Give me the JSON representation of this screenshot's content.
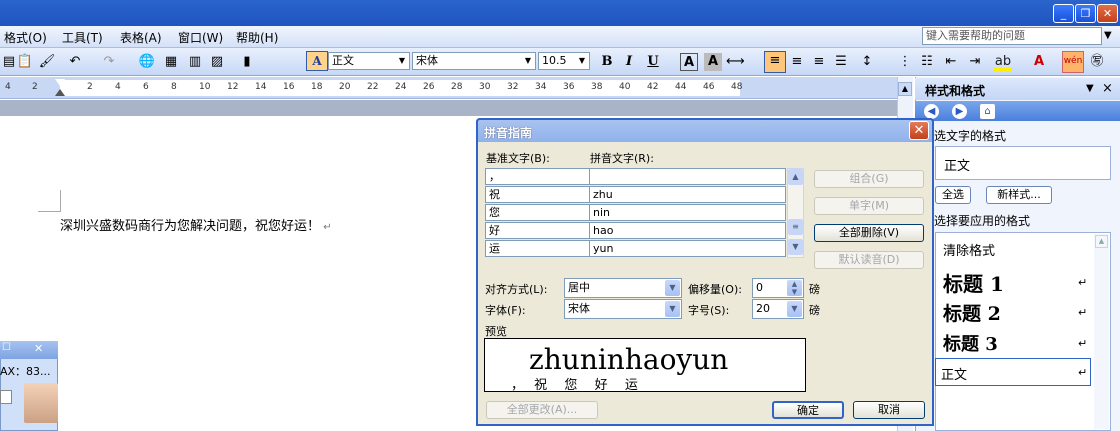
{
  "menubar": {
    "items": [
      "格式(O)",
      "工具(T)",
      "表格(A)",
      "窗口(W)",
      "帮助(H)"
    ],
    "help_placeholder": "键入需要帮助的问题"
  },
  "toolbar": {
    "style": "正文",
    "font": "宋体",
    "size": "10.5",
    "bold": "B",
    "italic": "I",
    "underline": "U"
  },
  "ruler": {
    "ticks": [
      "4",
      "2",
      "2",
      "4",
      "6",
      "8",
      "10",
      "12",
      "14",
      "16",
      "18",
      "20",
      "22",
      "24",
      "26",
      "28",
      "30",
      "32",
      "34",
      "36",
      "38",
      "40",
      "42",
      "44",
      "46",
      "48"
    ]
  },
  "document": {
    "text": "深圳兴盛数码商行为您解决问题，祝您好运！"
  },
  "task_pane": {
    "title": "样式和格式",
    "selected_format_label": "选文字的格式",
    "selected_format": "正文",
    "select_all": "全选",
    "new_style": "新样式...",
    "apply_label": "选择要应用的格式",
    "styles": [
      "清除格式",
      "标题 1",
      "标题 2",
      "标题 3",
      "正文"
    ]
  },
  "dialog": {
    "title": "拼音指南",
    "base_header": "基准文字(B):",
    "pinyin_header": "拼音文字(R):",
    "rows": [
      {
        "base": "，",
        "pinyin": ""
      },
      {
        "base": "祝",
        "pinyin": "zhu"
      },
      {
        "base": "您",
        "pinyin": "nin"
      },
      {
        "base": "好",
        "pinyin": "hao"
      },
      {
        "base": "运",
        "pinyin": "yun"
      }
    ],
    "buttons": {
      "combine": "组合(G)",
      "single": "单字(M)",
      "delete_all": "全部删除(V)",
      "default_reading": "默认读音(D)",
      "change_all": "全部更改(A)...",
      "ok": "确定",
      "cancel": "取消"
    },
    "alignment_label": "对齐方式(L):",
    "alignment": "居中",
    "offset_label": "偏移量(O):",
    "offset": "0",
    "offset_unit": "磅",
    "font_label": "字体(F):",
    "font": "宋体",
    "size_label": "字号(S):",
    "size": "20",
    "size_unit": "磅",
    "preview_label": "预览",
    "preview_pinyin": "zhuninhaoyun",
    "preview_base": "， 祝  您  好  运"
  },
  "side_fragment": {
    "text": "AX：83..."
  },
  "colors": {
    "title_blue": "#2b64cc",
    "dialog_border": "#3164c8",
    "dialog_bg": "#ece9d8",
    "close_red": "#c4401a"
  }
}
